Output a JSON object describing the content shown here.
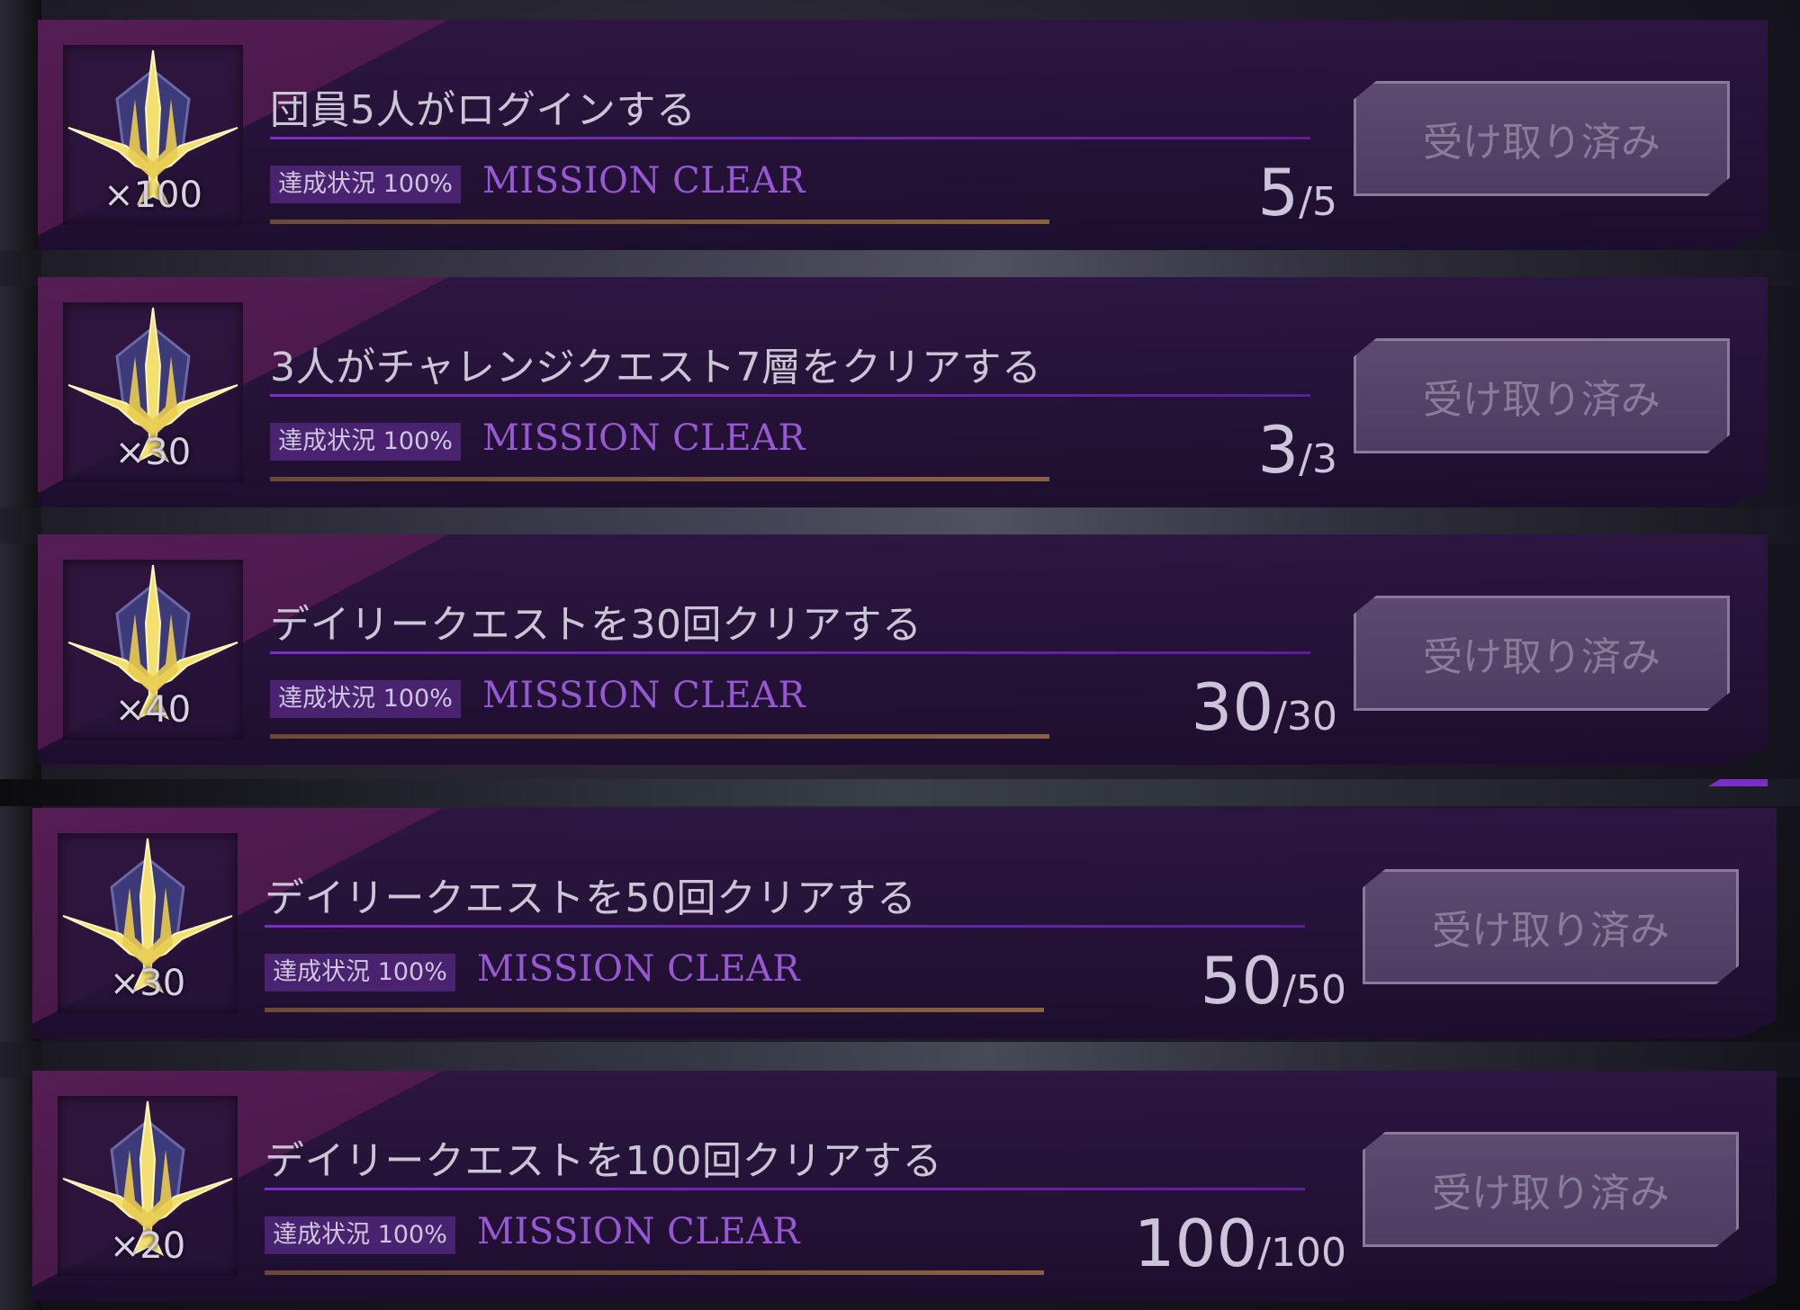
{
  "missions": [
    {
      "title": "団員5人がログインする",
      "reward_qty": "×100",
      "status_label": "達成状況 100%",
      "clear_label": "MISSION CLEAR",
      "progress_current": "5",
      "progress_max": "5",
      "button_label": "受け取り済み",
      "icon": "trident-emblem-icon"
    },
    {
      "title": "3人がチャレンジクエスト7層をクリアする",
      "reward_qty": "×30",
      "status_label": "達成状況 100%",
      "clear_label": "MISSION CLEAR",
      "progress_current": "3",
      "progress_max": "3",
      "button_label": "受け取り済み",
      "icon": "trident-emblem-icon"
    },
    {
      "title": "デイリークエストを30回クリアする",
      "reward_qty": "×40",
      "status_label": "達成状況 100%",
      "clear_label": "MISSION CLEAR",
      "progress_current": "30",
      "progress_max": "30",
      "button_label": "受け取り済み",
      "icon": "trident-emblem-icon"
    },
    {
      "title": "デイリークエストを50回クリアする",
      "reward_qty": "×30",
      "status_label": "達成状況 100%",
      "clear_label": "MISSION CLEAR",
      "progress_current": "50",
      "progress_max": "50",
      "button_label": "受け取り済み",
      "icon": "trident-emblem-icon"
    },
    {
      "title": "デイリークエストを100回クリアする",
      "reward_qty": "×20",
      "status_label": "達成状況 100%",
      "clear_label": "MISSION CLEAR",
      "progress_current": "100",
      "progress_max": "100",
      "button_label": "受け取り済み",
      "icon": "trident-emblem-icon"
    }
  ],
  "colors": {
    "accent_purple": "#7a2ec8",
    "clear_text": "#9858d4",
    "emblem_gold": "#f4e070",
    "button_bg": "#5c4a70"
  }
}
